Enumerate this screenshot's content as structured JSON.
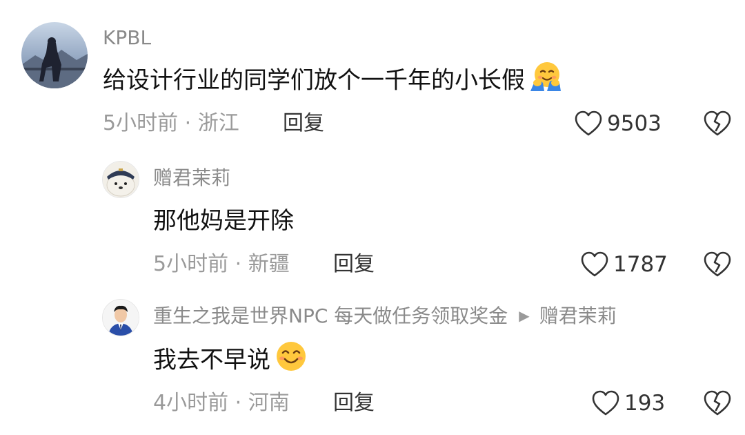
{
  "comments": [
    {
      "user": "KPBL",
      "text": "给设计行业的同学们放个一千年的小长假",
      "emoji": "hugging-face",
      "time": "5小时前",
      "location": "浙江",
      "reply_label": "回复",
      "likes": "9503"
    },
    {
      "user": "赠君茉莉",
      "text": "那他妈是开除",
      "time": "5小时前",
      "location": "新疆",
      "reply_label": "回复",
      "likes": "1787"
    },
    {
      "user": "重生之我是世界NPC 每天做任务领取奖金",
      "reply_to": "赠君茉莉",
      "text": "我去不早说",
      "emoji": "smiling-face",
      "time": "4小时前",
      "location": "河南",
      "reply_label": "回复",
      "likes": "193"
    }
  ],
  "separator": "·",
  "colors": {
    "username": "#8a8a8a",
    "body_text": "#111111",
    "meta": "#9a9a9a",
    "icon": "#333333"
  }
}
